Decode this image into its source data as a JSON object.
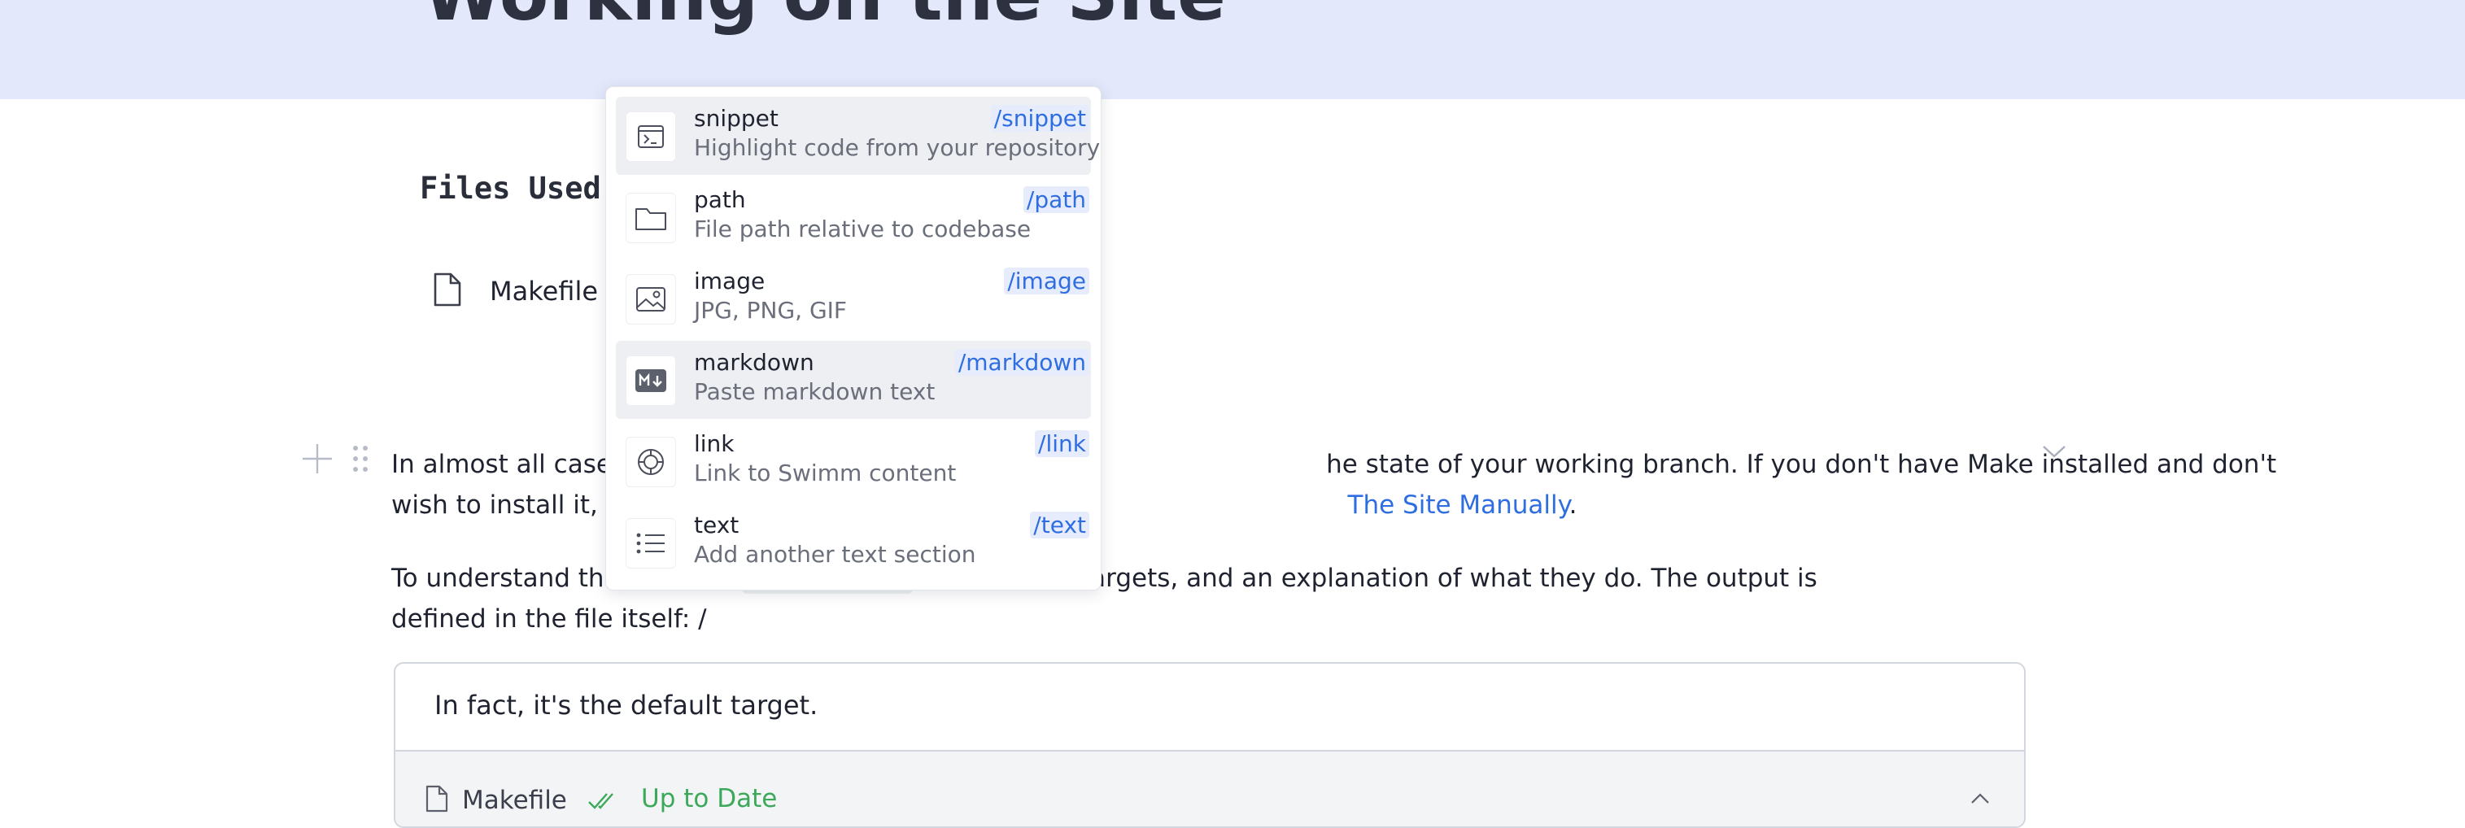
{
  "banner": {
    "title": "Working on the Site"
  },
  "files_section": {
    "heading": "Files Used:",
    "files": [
      {
        "name": "Makefile"
      }
    ]
  },
  "paragraphs": {
    "p1_start": "In almost all cases",
    "p1_right": "he state of your working branch. If you don't have Make installed and don't",
    "p1_line2_start": "wish to install it, th",
    "p1_link": "The Site Manually",
    "p1_end": ".",
    "p2_start": "To understand the",
    "p2_right": "he available targets, and an explanation of what they do. The output is",
    "p2_line2": "defined in the file itself: /"
  },
  "snippet_card": {
    "text": "In fact, it's the default target.",
    "file_name": "Makefile",
    "status": "Up to Date",
    "status_color": "#3ca85a"
  },
  "command_menu": {
    "items": [
      {
        "title": "snippet",
        "description": "Highlight code from your repository",
        "command": "/snippet",
        "icon": "terminal-icon",
        "highlighted": true
      },
      {
        "title": "path",
        "description": "File path relative to codebase",
        "command": "/path",
        "icon": "folder-icon",
        "highlighted": false
      },
      {
        "title": "image",
        "description": "JPG, PNG, GIF",
        "command": "/image",
        "icon": "image-icon",
        "highlighted": false
      },
      {
        "title": "markdown",
        "description": "Paste markdown text",
        "command": "/markdown",
        "icon": "markdown-icon",
        "highlighted": true
      },
      {
        "title": "link",
        "description": "Link to Swimm content",
        "command": "/link",
        "icon": "link-icon",
        "highlighted": false
      },
      {
        "title": "text",
        "description": "Add another text section",
        "command": "/text",
        "icon": "list-icon",
        "highlighted": false
      }
    ]
  },
  "colors": {
    "accent": "#2f6ee0",
    "banner_bg": "#e4e8fb",
    "success": "#3ca85a"
  }
}
